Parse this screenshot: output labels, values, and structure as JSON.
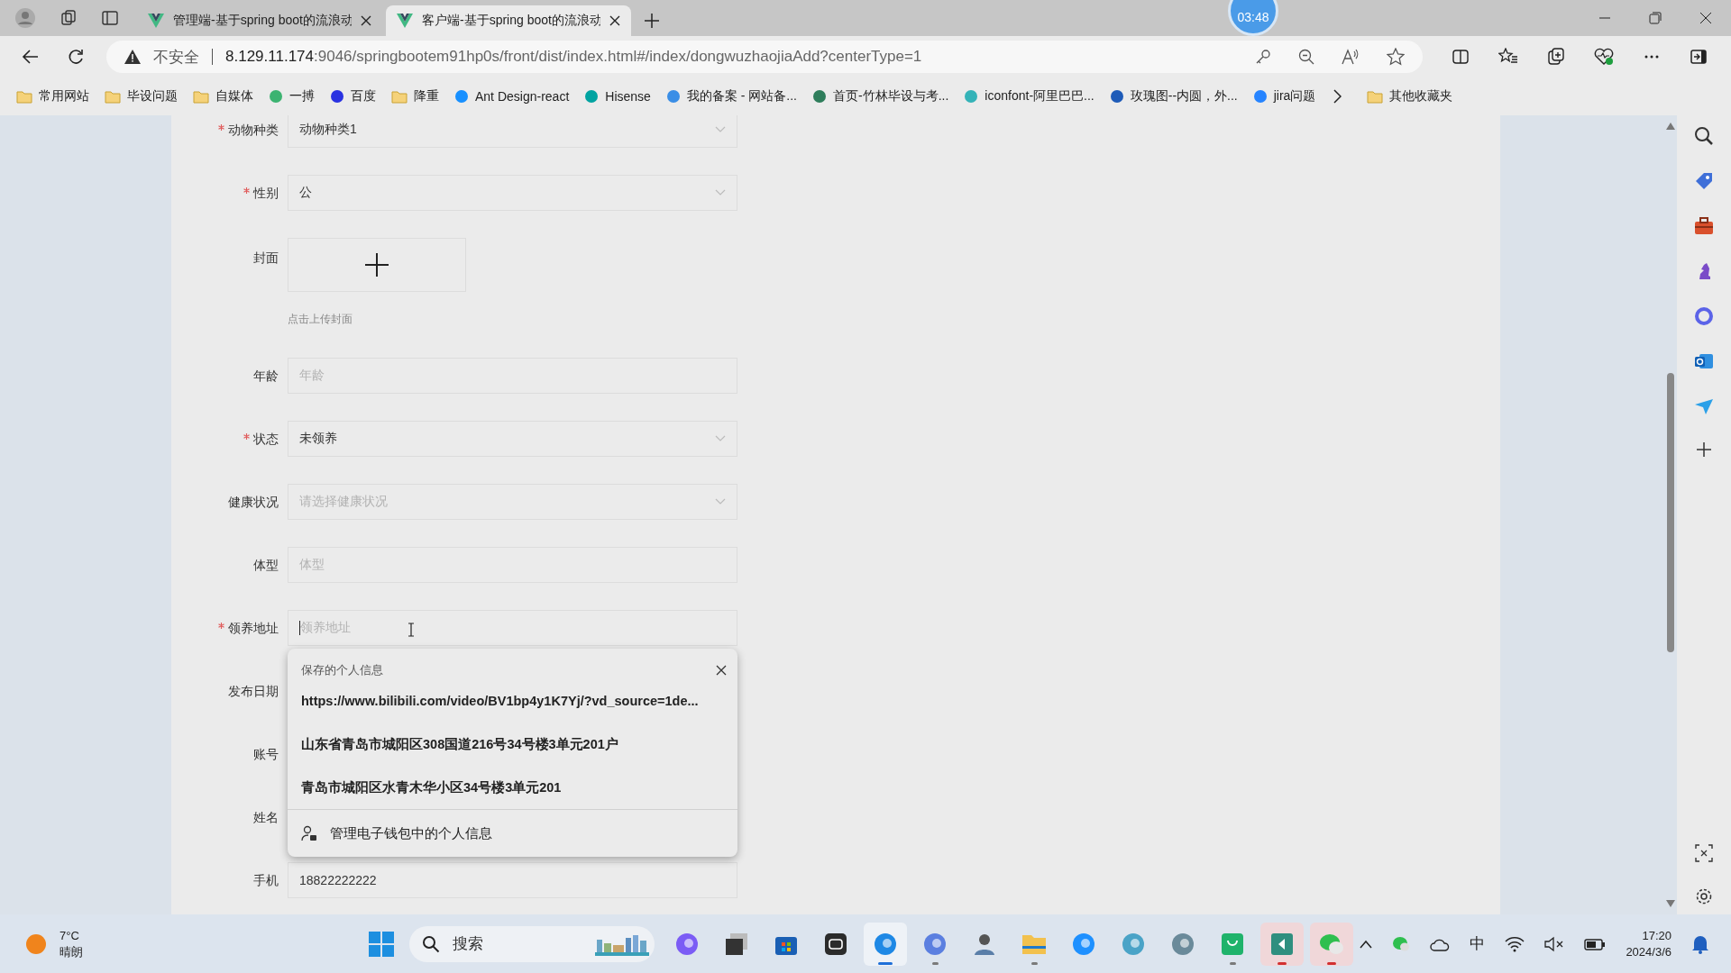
{
  "timer": "03:48",
  "tabs": [
    {
      "title": "管理端-基于spring boot的流浪动",
      "selected": false
    },
    {
      "title": "客户端-基于spring boot的流浪动",
      "selected": true
    }
  ],
  "address": {
    "security": "不安全",
    "host": "8.129.11.174",
    "path": ":9046/springbootem91hp0s/front/dist/index.html#/index/dongwuzhaojiaAdd?centerType=1"
  },
  "bookmarks": [
    {
      "label": "常用网站",
      "kind": "folder"
    },
    {
      "label": "毕设问题",
      "kind": "folder"
    },
    {
      "label": "自媒体",
      "kind": "folder"
    },
    {
      "label": "一搏",
      "kind": "site",
      "color": "#3cb371"
    },
    {
      "label": "百度",
      "kind": "site",
      "color": "#2932e1"
    },
    {
      "label": "降重",
      "kind": "folder"
    },
    {
      "label": "Ant Design-react",
      "kind": "site",
      "color": "#1890ff"
    },
    {
      "label": "Hisense",
      "kind": "site",
      "color": "#00a3a1"
    },
    {
      "label": "我的备案 - 网站备...",
      "kind": "site",
      "color": "#3a8ee6"
    },
    {
      "label": "首页-竹林毕设与考...",
      "kind": "site",
      "color": "#2e7d5b"
    },
    {
      "label": "iconfont-阿里巴巴...",
      "kind": "site",
      "color": "#34b3b8"
    },
    {
      "label": "玫瑰图--内圆，外...",
      "kind": "site",
      "color": "#1e5bb8"
    },
    {
      "label": "jira问题",
      "kind": "site",
      "color": "#2684ff"
    }
  ],
  "other_bookmarks": "其他收藏夹",
  "form": [
    {
      "label": "动物种类",
      "kind": "select",
      "required": true,
      "value": "动物种类1"
    },
    {
      "label": "性别",
      "kind": "select",
      "required": true,
      "value": "公"
    },
    {
      "label": "封面",
      "kind": "upload",
      "required": false,
      "hint": "点击上传封面"
    },
    {
      "label": "年龄",
      "kind": "input",
      "required": false,
      "placeholder": "年龄"
    },
    {
      "label": "状态",
      "kind": "select",
      "required": true,
      "value": "未领养"
    },
    {
      "label": "健康状况",
      "kind": "select",
      "required": false,
      "placeholder": "请选择健康状况"
    },
    {
      "label": "体型",
      "kind": "input",
      "required": false,
      "placeholder": "体型"
    },
    {
      "label": "领养地址",
      "kind": "input",
      "required": true,
      "placeholder": "领养地址",
      "focused": true
    },
    {
      "label": "发布日期",
      "kind": "hidden",
      "required": false
    },
    {
      "label": "账号",
      "kind": "hidden",
      "required": false
    },
    {
      "label": "姓名",
      "kind": "hidden",
      "required": false
    },
    {
      "label": "手机",
      "kind": "input",
      "required": false,
      "value": "18822222222"
    }
  ],
  "autofill": {
    "title": "保存的个人信息",
    "suggestions": [
      "https://www.bilibili.com/video/BV1bp4y1K7Yj/?vd_source=1de...",
      "山东省青岛市城阳区308国道216号34号楼3单元201户",
      "青岛市城阳区水青木华小区34号楼3单元201"
    ],
    "manage": "管理电子钱包中的个人信息"
  },
  "weather": {
    "temp": "7°C",
    "condition": "晴朗"
  },
  "taskbar_search": "搜索",
  "taskbar_apps": [
    {
      "kind": "copilot",
      "open": false,
      "active": false,
      "alert": false
    },
    {
      "kind": "window",
      "open": false,
      "active": false,
      "alert": false
    },
    {
      "kind": "store",
      "open": false,
      "active": false,
      "alert": false
    },
    {
      "kind": "robot",
      "open": false,
      "active": false,
      "alert": false
    },
    {
      "kind": "edge",
      "open": true,
      "active": true,
      "alert": false
    },
    {
      "kind": "swirl",
      "open": true,
      "active": false,
      "alert": false
    },
    {
      "kind": "person",
      "open": false,
      "active": false,
      "alert": false
    },
    {
      "kind": "folder",
      "open": true,
      "active": false,
      "alert": false
    },
    {
      "kind": "ie",
      "open": false,
      "active": false,
      "alert": false
    },
    {
      "kind": "flower",
      "open": false,
      "active": false,
      "alert": false
    },
    {
      "kind": "globe",
      "open": false,
      "active": false,
      "alert": false
    },
    {
      "kind": "bag",
      "open": true,
      "active": false,
      "alert": false
    },
    {
      "kind": "back",
      "open": true,
      "active": false,
      "alert": true
    },
    {
      "kind": "chat",
      "open": true,
      "active": false,
      "alert": true
    }
  ],
  "tray": {
    "ime": "中",
    "time": "17:20",
    "date": "2024/3/6"
  }
}
